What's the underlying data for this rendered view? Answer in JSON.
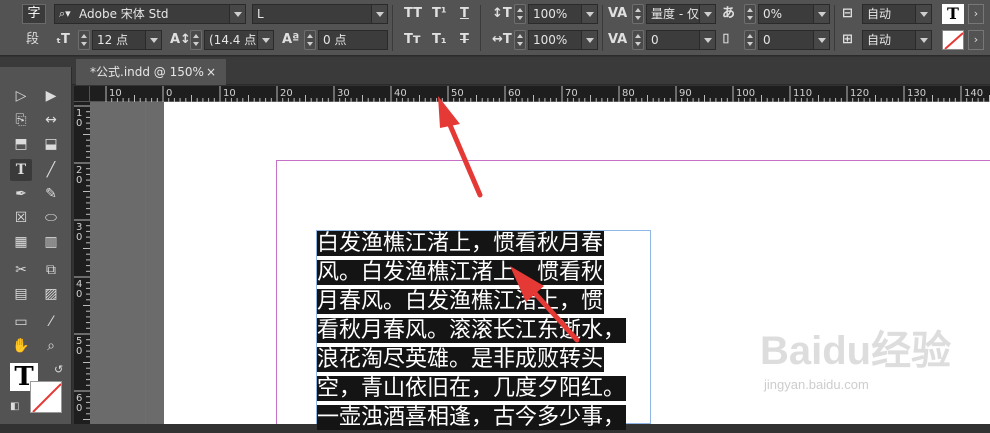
{
  "control_panel": {
    "char_icon": "字",
    "para_icon": "段",
    "font_family": "Adobe 宋体 Std",
    "font_style": "L",
    "font_size": "12 点",
    "leading": "(14.4 点",
    "kerning": "0 点",
    "vertical_scale": "100%",
    "horizontal_scale": "100%",
    "tracking_mode": "量度 - 仅",
    "tracking_value": "0",
    "baseline_shift": "0%",
    "aki_value": "0",
    "spacing_right": "0",
    "auto_1": "自动",
    "auto_2": "自动"
  },
  "tab": {
    "title": "*公式.indd @ 150%",
    "close": "×"
  },
  "ruler": {
    "h_labels": [
      "10",
      "0",
      "10",
      "20",
      "30",
      "40",
      "50",
      "60",
      "70",
      "80",
      "90",
      "100",
      "110",
      "120",
      "130",
      "140"
    ],
    "v_labels": [
      "1\n0",
      "2\n0",
      "3\n0",
      "4\n0",
      "5\n0",
      "6\n0"
    ]
  },
  "text_lines": [
    "白发渔樵江渚上，惯看秋月春",
    "风。白发渔樵江渚上，惯看秋",
    "月春风。白发渔樵江渚上，惯",
    "看秋月春风。滚滚长江东逝水，",
    "浪花淘尽英雄。是非成败转头",
    "空，青山依旧在，几度夕阳红。",
    "一壶浊酒喜相逢，古今多少事，"
  ],
  "watermark": {
    "brand": "Baidu经验",
    "url": "jingyan.baidu.com"
  },
  "colors": {
    "highlight": "#141414",
    "margin": "#c671c6",
    "arrow": "#e53935",
    "bleed": "#e53b3b"
  }
}
